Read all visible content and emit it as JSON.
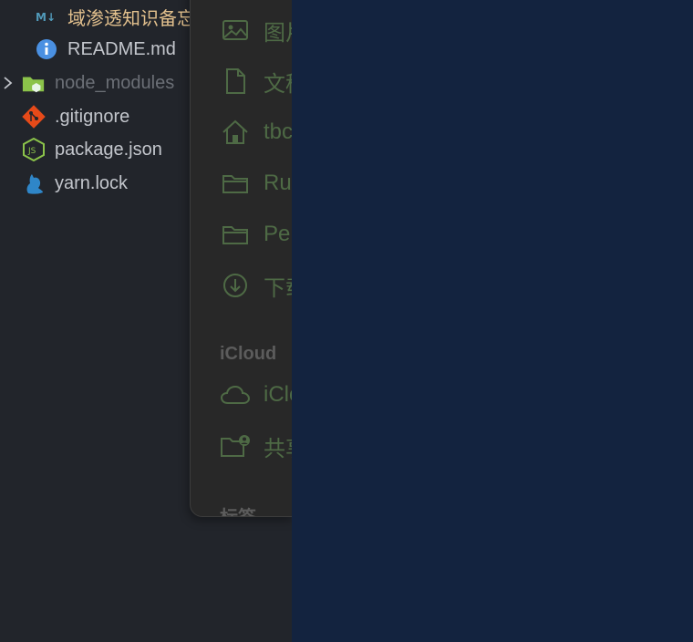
{
  "explorer": {
    "items": [
      {
        "label": "域渗透知识备忘",
        "icon": "markdown-icon"
      },
      {
        "label": "README.md",
        "icon": "info-icon"
      },
      {
        "label": "node_modules",
        "icon": "folder-icon"
      },
      {
        "label": ".gitignore",
        "icon": "git-icon"
      },
      {
        "label": "package.json",
        "icon": "nodejs-icon"
      },
      {
        "label": "yarn.lock",
        "icon": "yarn-icon"
      }
    ]
  },
  "finder": {
    "favorites": [
      {
        "label": "图片",
        "icon": "photo-icon"
      },
      {
        "label": "文稿",
        "icon": "document-icon"
      },
      {
        "label": "tbc",
        "icon": "home-icon"
      },
      {
        "label": "Ru",
        "icon": "folder-icon"
      },
      {
        "label": "Pe",
        "icon": "folder-icon"
      },
      {
        "label": "下载",
        "icon": "download-icon"
      }
    ],
    "icloud_header": "iCloud",
    "icloud": [
      {
        "label": "iCloud",
        "icon": "cloud-icon"
      },
      {
        "label": "共享",
        "icon": "shared-folder-icon"
      }
    ],
    "tags_header": "标签"
  },
  "colors": {
    "explorer_bg": "#22252b",
    "finder_bg": "#282828",
    "finder_icon": "#4e6a45",
    "right_bg": "#13233f",
    "modified_text": "#e2c08d"
  }
}
